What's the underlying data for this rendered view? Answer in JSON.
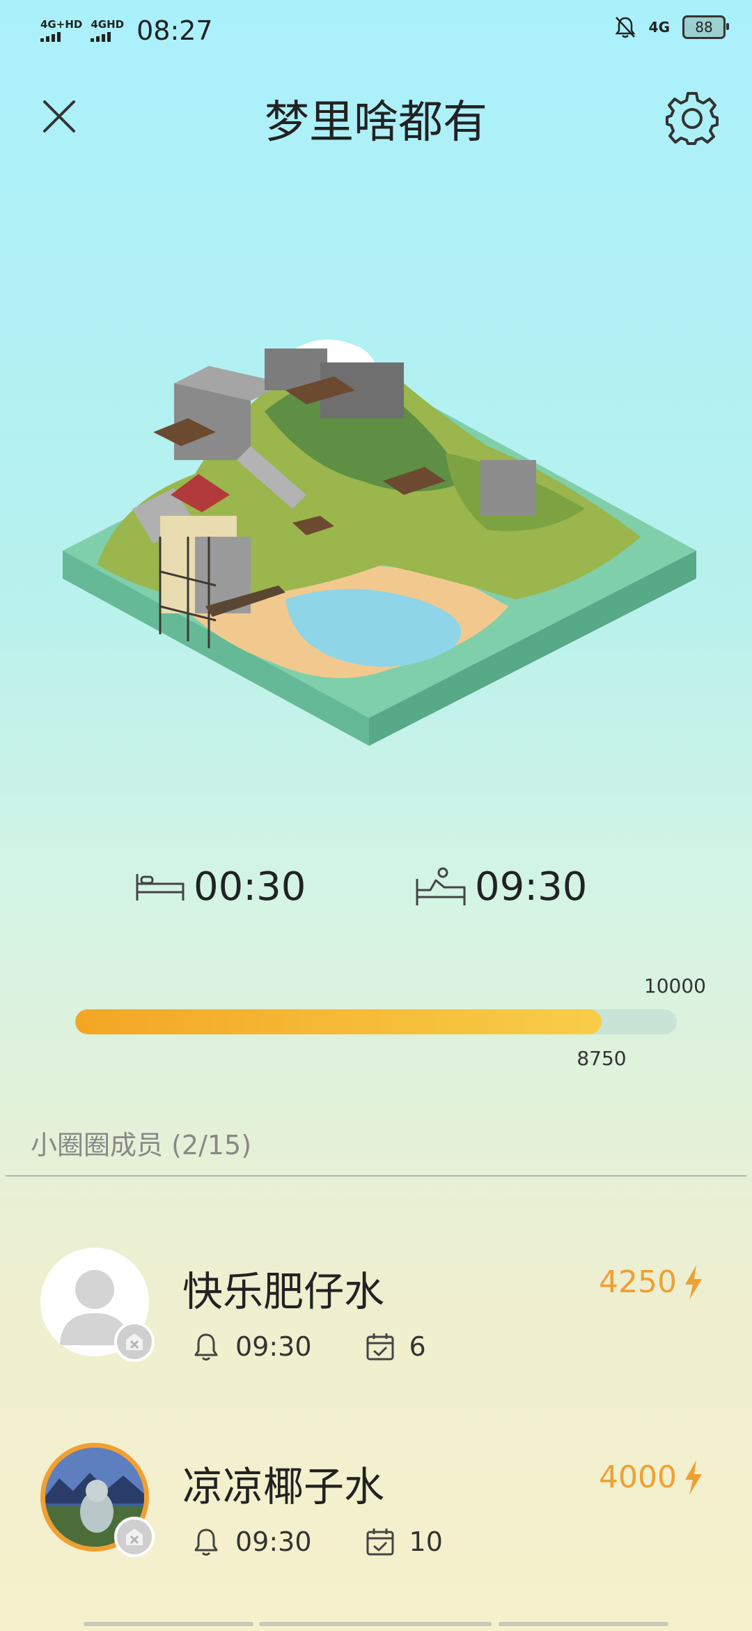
{
  "status_bar": {
    "signal1_label": "4G+HD",
    "signal2_label": "4GHD",
    "time": "08:27",
    "network": "4G",
    "battery": "88",
    "icons": [
      "mute-bell-icon",
      "signal-icon",
      "battery-icon"
    ]
  },
  "header": {
    "title": "梦里啥都有",
    "close_icon": "close-icon",
    "settings_icon": "gear-icon"
  },
  "scene": {
    "image": "isometric-great-wall-island"
  },
  "schedule": {
    "sleep_time": "00:30",
    "wake_time": "09:30",
    "sleep_icon": "bed-sleep-icon",
    "wake_icon": "bed-wake-icon"
  },
  "progress": {
    "max_label": "10000",
    "current_label": "8750",
    "fraction": 0.875,
    "colors": {
      "fill_start": "#f3a624",
      "fill_end": "#f8cd48",
      "track": "#c9e4d6"
    }
  },
  "members_section": {
    "title": "小圈圈成员 (2/15)"
  },
  "members": [
    {
      "name": "快乐肥仔水",
      "score": "4250",
      "alarm_time": "09:30",
      "days": "6",
      "avatar": "default-person-avatar"
    },
    {
      "name": "凉凉椰子水",
      "score": "4000",
      "alarm_time": "09:30",
      "days": "10",
      "avatar": "landscape-photo-avatar"
    }
  ],
  "accent_color": "#f0a032"
}
